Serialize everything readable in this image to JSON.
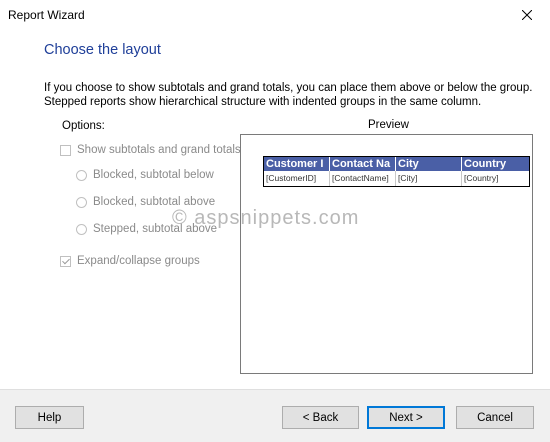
{
  "window": {
    "title": "Report Wizard"
  },
  "page": {
    "heading": "Choose the layout",
    "intro": "If you choose to show subtotals and grand totals, you can place them above or below the group. Stepped reports show hierarchical structure with indented groups in the same column."
  },
  "options": {
    "label": "Options:",
    "show_totals": {
      "label": "Show subtotals and grand totals",
      "checked": false,
      "enabled": false
    },
    "radios": [
      {
        "label": "Blocked, subtotal below",
        "selected": false,
        "enabled": false
      },
      {
        "label": "Blocked, subtotal above",
        "selected": false,
        "enabled": false
      },
      {
        "label": "Stepped, subtotal above",
        "selected": false,
        "enabled": false
      }
    ],
    "expand_collapse": {
      "label": "Expand/collapse groups",
      "checked": true,
      "enabled": false
    }
  },
  "preview": {
    "label": "Preview",
    "columns": [
      "Customer I",
      "Contact Na",
      "City",
      "Country"
    ],
    "row": [
      "[CustomerID]",
      "[ContactName]",
      "[City]",
      "[Country]"
    ],
    "header_color": "#4a5fa6"
  },
  "watermark": "© aspsnippets.com",
  "footer": {
    "help": "Help",
    "back": "< Back",
    "next": "Next >",
    "cancel": "Cancel"
  },
  "colors": {
    "heading": "#1f3f99",
    "footer_bg": "#f0f0f0",
    "default_button_border": "#0078d7"
  }
}
